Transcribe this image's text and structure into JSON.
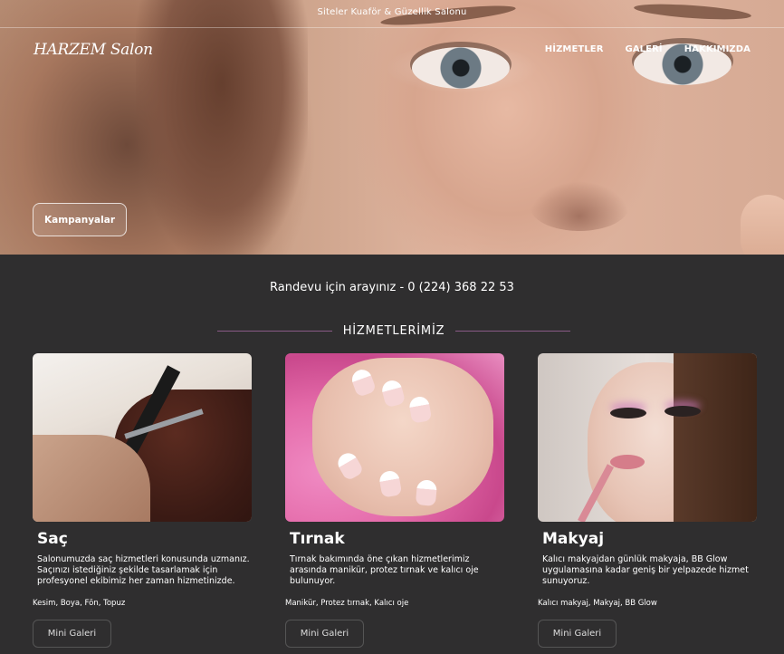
{
  "header": {
    "tagline": "Siteler Kuaför & Güzellik Salonu",
    "logo": "HARZEM Salon",
    "nav": [
      "HİZMETLER",
      "GALERİ",
      "HAKKIMIZDA"
    ],
    "campaign_button": "Kampanyalar"
  },
  "contact": {
    "call_text": "Randevu için arayınız - 0 (224) 368 22 53"
  },
  "services": {
    "section_title": "HİZMETLERİMİZ",
    "items": [
      {
        "title": "Saç",
        "description": "Salonumuzda saç hizmetleri konusunda uzmanız. Saçınızı istediğiniz şekilde tasarlamak için profesyonel ekibimiz her zaman hizmetinizde.",
        "tags": "Kesim, Boya, Fön, Topuz",
        "button": "Mini Galeri"
      },
      {
        "title": "Tırnak",
        "description": "Tırnak bakımında öne çıkan hizmetlerimiz arasında manikür, protez tırnak ve kalıcı oje bulunuyor.",
        "tags": "Manikür, Protez tırnak, Kalıcı oje",
        "button": "Mini Galeri"
      },
      {
        "title": "Makyaj",
        "description": "Kalıcı makyajdan günlük makyaja, BB Glow uygulamasına kadar geniş bir yelpazede hizmet sunuyoruz.",
        "tags": "Kalıcı makyaj, Makyaj, BB Glow",
        "button": "Mini Galeri"
      }
    ]
  },
  "colors": {
    "background": "#2f2e2f",
    "divider_accent": "#8a5a86"
  }
}
